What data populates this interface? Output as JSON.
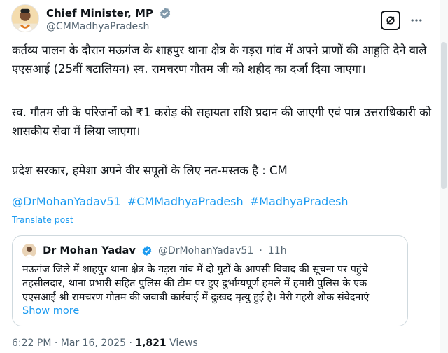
{
  "author": {
    "display_name": "Chief Minister, MP",
    "handle": "@CMMadhyaPradesh"
  },
  "icons": {
    "verified": "verified-badge-icon",
    "grok": "grok-icon",
    "more": "more-options-icon"
  },
  "tweet": {
    "paragraph_1": "कर्तव्य पालन के दौरान मऊगंज के शाहपुर थाना क्षेत्र के गड़रा गांव में अपने प्राणों की आहुति देने वाले एएसआई (25वीं बटालियन) स्व. रामचरण गौतम जी को शहीद का दर्जा दिया जाएगा।",
    "paragraph_2": "स्व. गौतम जी के परिजनों को ₹1 करोड़ की सहायता राशि प्रदान की जाएगी एवं पात्र उत्तराधिकारी को शासकीय सेवा में लिया जाएगा।",
    "paragraph_3": "प्रदेश सरकार, हमेशा अपने वीर सपूतों के लिए नत-मस्तक है : CM",
    "hashtags": [
      "@DrMohanYadav51",
      "#CMMadhyaPradesh",
      "#MadhyaPradesh"
    ],
    "translate_label": "Translate post"
  },
  "quoted": {
    "display_name": "Dr Mohan Yadav",
    "handle": "@DrMohanYadav51",
    "separator": "·",
    "age": "11h",
    "text": "मऊगंज जिले में शाहपुर थाना क्षेत्र के गड़रा गांव में दो गुटों के आपसी विवाद की सूचना पर पहुंचे तहसीलदार, थाना प्रभारी सहित पुलिस की टीम पर हुए दुर्भाग्यपूर्ण हमले में हमारी पुलिस के एक एएसआई श्री रामचरण गौतम की जवाबी कार्रवाई में दुःखद मृत्यु हुई है। मेरी गहरी शोक संवेदनाएं",
    "show_more": "Show more"
  },
  "meta": {
    "time": "6:22 PM",
    "dot1": "·",
    "date": "Mar 16, 2025",
    "dot2": "·",
    "views_count": "1,821",
    "views_label": "Views"
  },
  "colors": {
    "link": "#1d9bf0",
    "secondary_text": "#536471",
    "border": "#cfd9de"
  }
}
